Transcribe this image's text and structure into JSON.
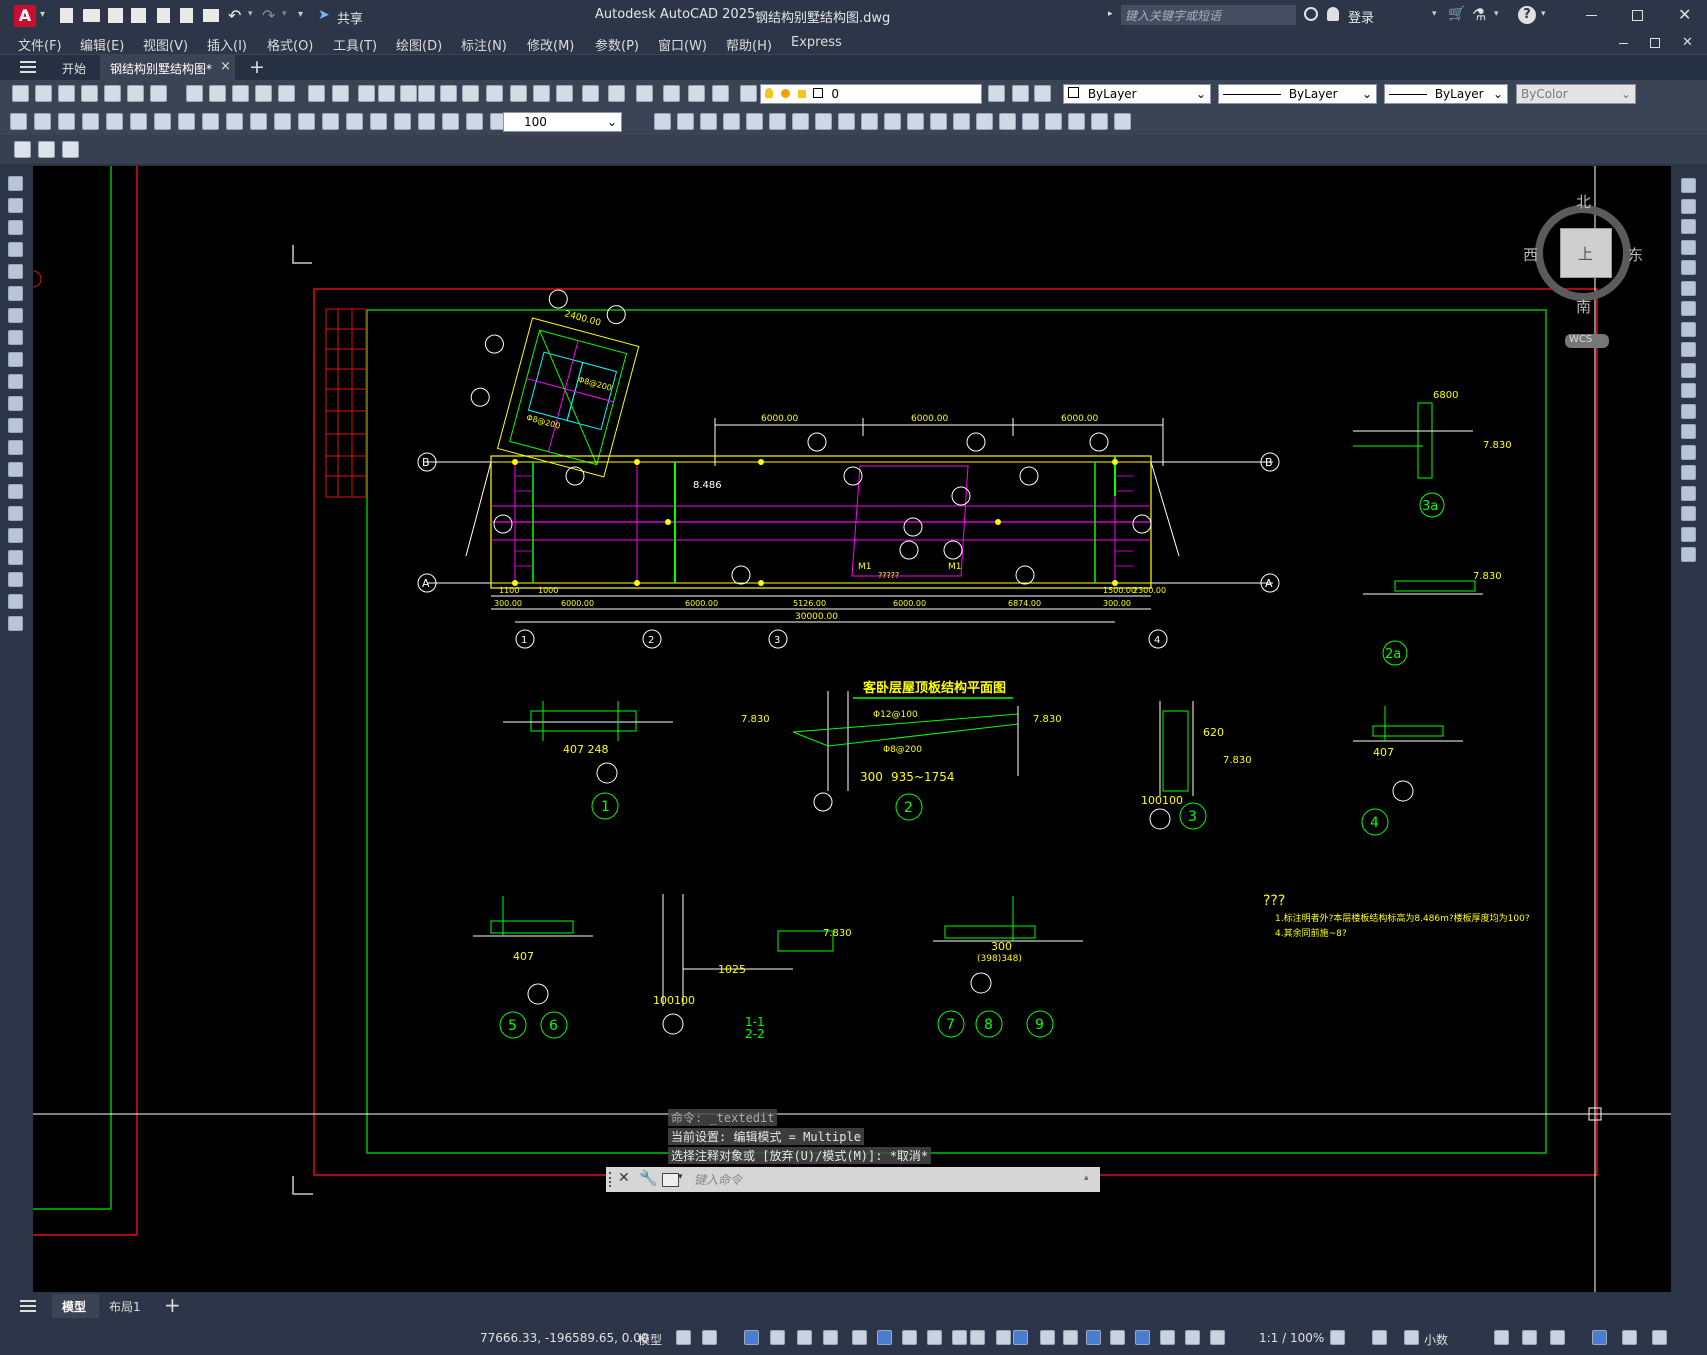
{
  "window": {
    "app_title": "Autodesk AutoCAD 2025",
    "file_title": "钢结构别墅结构图.dwg",
    "share_label": "共享",
    "search_placeholder": "键入关键字或短语",
    "login_label": "登录",
    "logo_letter": "A"
  },
  "menu": [
    "文件(F)",
    "编辑(E)",
    "视图(V)",
    "插入(I)",
    "格式(O)",
    "工具(T)",
    "绘图(D)",
    "标注(N)",
    "修改(M)",
    "参数(P)",
    "窗口(W)",
    "帮助(H)",
    "Express"
  ],
  "doc_tabs": {
    "start": "开始",
    "active": "钢结构别墅结构图*",
    "close": "×",
    "add": "+"
  },
  "toolbar": {
    "layer_value": "0",
    "color_value": "ByLayer",
    "linetype_value": "ByLayer",
    "lineweight_value": "ByLayer",
    "plotstyle_value": "ByColor",
    "dim_scale_value": "100"
  },
  "viewcube": {
    "north": "北",
    "south": "南",
    "east": "东",
    "west": "西",
    "top": "上",
    "wcs": "WCS"
  },
  "drawing": {
    "plan_title": "客卧层屋顶板结构平面图",
    "axis_letters": [
      "A",
      "B"
    ],
    "axis_numbers": [
      "1",
      "2",
      "3",
      "4"
    ],
    "dims_top": [
      "6000.00",
      "6000.00",
      "6000.00"
    ],
    "dims_bottom": [
      "1100",
      "1000",
      "300.00",
      "6000.00",
      "6000.00",
      "5126.00",
      "6000.00",
      "6874.00",
      "1500.00",
      "2300.00",
      "300.00"
    ],
    "total_dim": "30000.00",
    "elev_plan": "8.486",
    "sec1": "1",
    "sec2": "2",
    "sec3": "3",
    "sec4": "4",
    "sec5": "5",
    "sec6": "6",
    "sec7": "7",
    "sec8": "8",
    "sec9": "9",
    "sec2a": "2a",
    "sec3a": "3a",
    "sec1_dim": "407    248",
    "sec2_dim": "935~1754",
    "sec2_300": "300",
    "elev_7830": "7.830",
    "sec2_rebar1": "Φ12@100",
    "sec2_rebar2": "Φ8@200",
    "sec3_dim": "100100",
    "sec3_620": "620",
    "sec4_407": "407",
    "sec5_407": "407",
    "sec6_1025": "1025",
    "sec6_100100": "100100",
    "sec6_label1": "1-1",
    "sec6_label2": "2-2",
    "sec8_300": "300",
    "sec8_dim": "(398)348)",
    "notes_head": "???",
    "note1": "1.标注明者外?本层楼板结构标高为8.486m?楼板厚度均为100?",
    "note2": "4.其余同前施~8?",
    "m1": "M1",
    "qq": "?????"
  },
  "command": {
    "line1": "命令: _textedit",
    "line2": "当前设置: 编辑模式 = Multiple",
    "line3": "选择注释对象或 [放弃(U)/模式(M)]: *取消*",
    "placeholder": "键入命令"
  },
  "layout_tabs": [
    "模型",
    "布局1"
  ],
  "status": {
    "coords": "77666.33, -196589.65, 0.00",
    "mode": "模型",
    "scale": "1:1 / 100%",
    "units": "小数"
  }
}
